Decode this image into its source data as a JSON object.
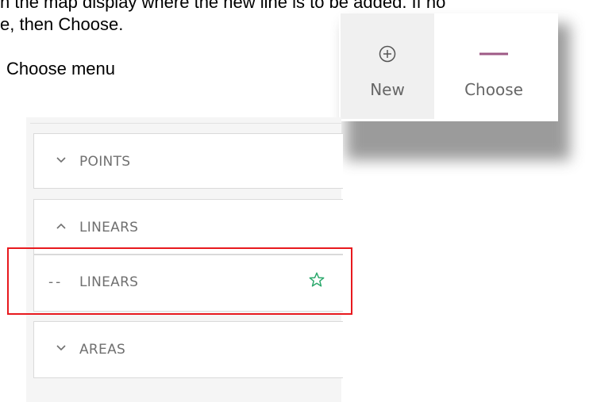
{
  "instructions": {
    "line1": "n the map display where the new line is to be added. If no",
    "line2": "e, then Choose.",
    "caption": "Choose menu"
  },
  "toolbar": {
    "new_label": "New",
    "new_icon": "plus-circle-icon",
    "choose_label": "Choose",
    "choose_icon": "line-icon",
    "choose_icon_color": "#9e5a86"
  },
  "panel": {
    "sections": [
      {
        "label": "POINTS",
        "state": "collapsed",
        "chevron": "chevron-down-icon"
      },
      {
        "label": "LINEARS",
        "state": "expanded",
        "chevron": "chevron-up-icon"
      },
      {
        "label": "AREAS",
        "state": "collapsed",
        "chevron": "chevron-down-icon"
      }
    ],
    "linears_items": [
      {
        "prefix": "--",
        "label": "LINEARS",
        "favorite_icon": "star-outline-icon",
        "favorite_color": "#2aa86b"
      }
    ]
  },
  "highlight": {
    "color": "#e8191e",
    "target": "LINEARS item"
  }
}
